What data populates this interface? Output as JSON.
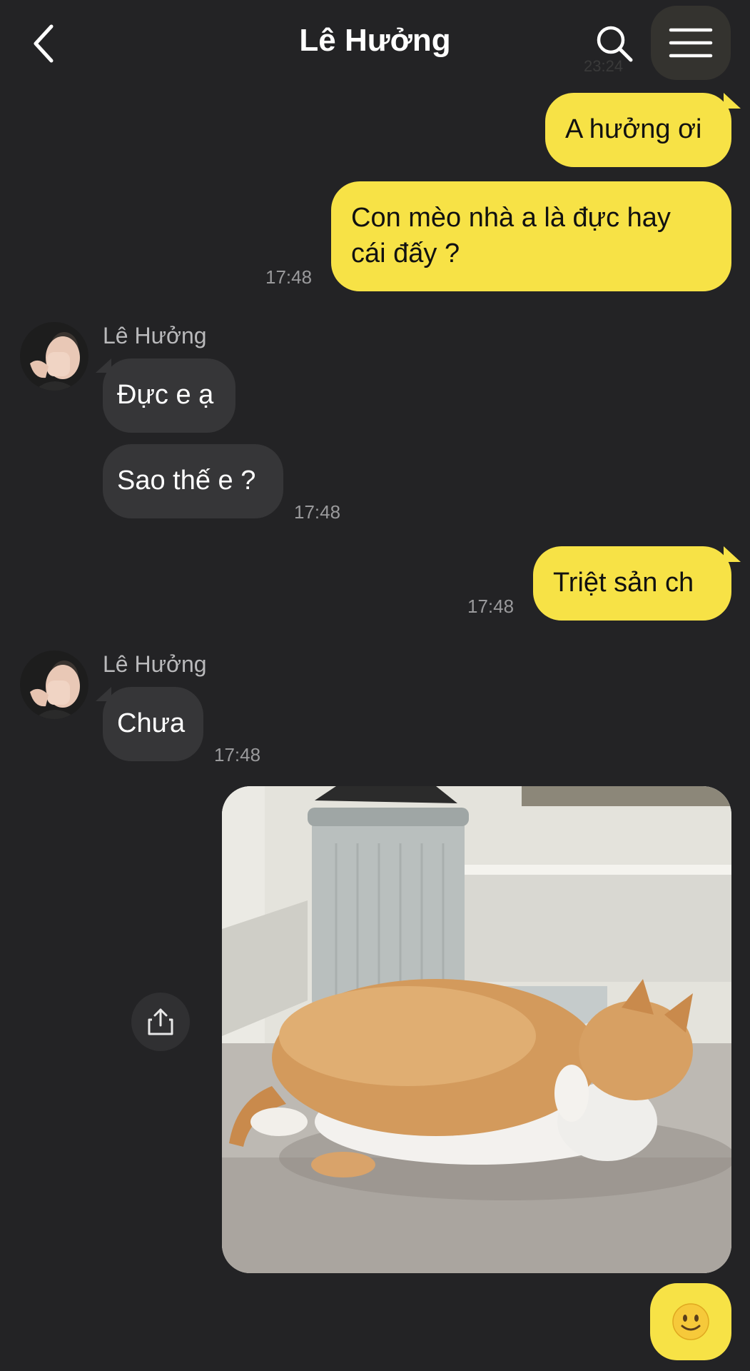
{
  "header": {
    "title": "Lê Hưởng",
    "ghost_time": "23:24"
  },
  "messages": [
    {
      "dir": "out",
      "text": "A hưởng ơi"
    },
    {
      "dir": "out",
      "text": "Con mèo nhà a là đực hay cái đấy ?",
      "time": "17:48"
    },
    {
      "dir": "in",
      "sender": "Lê Hưởng",
      "text": "Đực e ạ"
    },
    {
      "dir": "in",
      "text": "Sao thế e ?",
      "time": "17:48"
    },
    {
      "dir": "out",
      "text": "Triệt sản ch",
      "time": "17:48"
    },
    {
      "dir": "in",
      "sender": "Lê Hưởng",
      "text": "Chưa",
      "time": "17:48"
    }
  ],
  "icons": {
    "back": "chevron-left-icon",
    "search": "search-icon",
    "menu": "hamburger-menu-icon",
    "share": "share-icon",
    "emoji": "smiley-emoji-icon"
  },
  "colors": {
    "background": "#232325",
    "outgoing_bubble": "#f7e246",
    "incoming_bubble": "#363638"
  }
}
